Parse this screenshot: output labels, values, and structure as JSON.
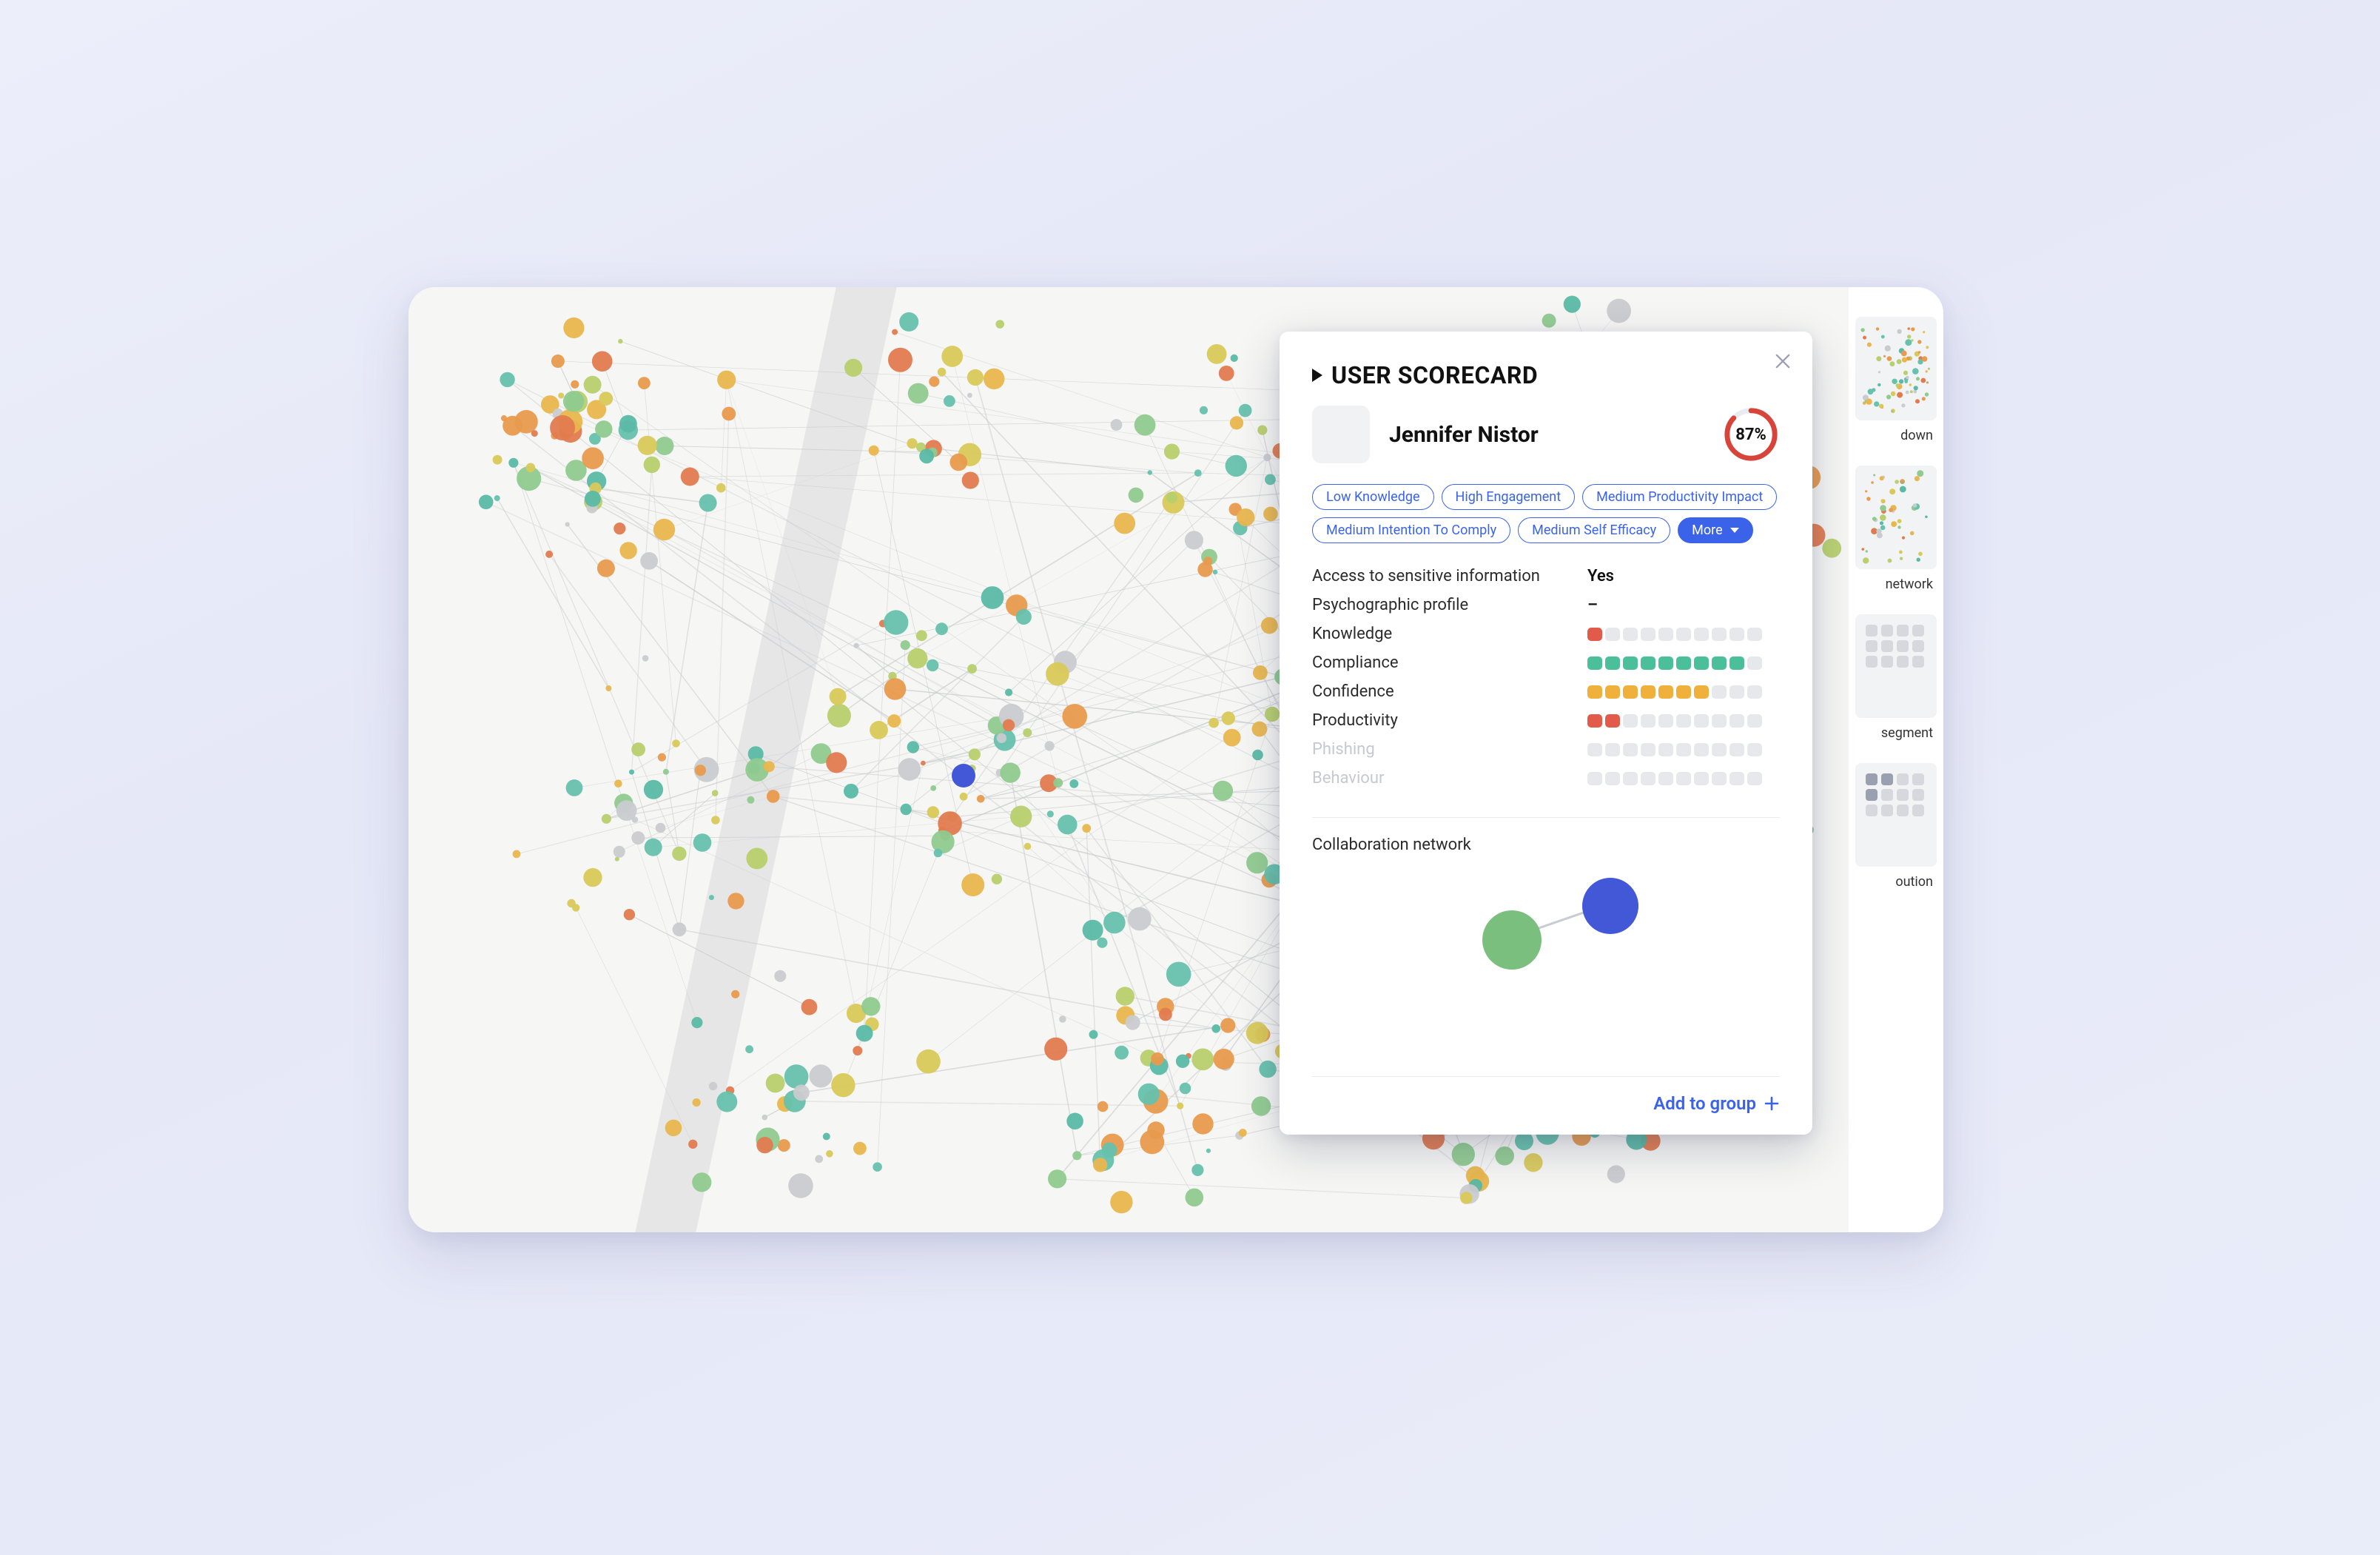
{
  "card": {
    "title": "USER SCORECARD",
    "close_icon": "close",
    "user": {
      "name": "Jennifer Nistor",
      "score_percent": 87,
      "score_label": "87%"
    },
    "tags": [
      {
        "label": "Low Knowledge"
      },
      {
        "label": "High Engagement"
      },
      {
        "label": "Medium Productivity Impact"
      },
      {
        "label": "Medium Intention To Comply"
      },
      {
        "label": "Medium Self Efficacy"
      }
    ],
    "more_label": "More",
    "metrics": {
      "access_label": "Access to sensitive information",
      "access_value": "Yes",
      "psycho_label": "Psychographic profile",
      "psycho_value": "–",
      "knowledge_label": "Knowledge",
      "knowledge_bar": [
        "r",
        "",
        "",
        "",
        "",
        "",
        "",
        "",
        "",
        ""
      ],
      "compliance_label": "Compliance",
      "compliance_bar": [
        "g",
        "g",
        "g",
        "g",
        "g",
        "g",
        "g",
        "g",
        "g",
        ""
      ],
      "confidence_label": "Confidence",
      "confidence_bar": [
        "o",
        "o",
        "o",
        "o",
        "o",
        "o",
        "o",
        "",
        "",
        ""
      ],
      "productivity_label": "Productivity",
      "productivity_bar": [
        "r",
        "r",
        "",
        "",
        "",
        "",
        "",
        "",
        "",
        ""
      ],
      "phishing_label": "Phishing",
      "phishing_bar": [
        "",
        "",
        "",
        "",
        "",
        "",
        "",
        "",
        "",
        ""
      ],
      "behaviour_label": "Behaviour",
      "behaviour_bar": [
        "",
        "",
        "",
        "",
        "",
        "",
        "",
        "",
        "",
        ""
      ]
    },
    "collab_label": "Collaboration network",
    "add_group_label": "Add to group"
  },
  "right_col": {
    "items": [
      {
        "caption": "down"
      },
      {
        "caption": "network"
      },
      {
        "caption": "segment"
      },
      {
        "caption": "oution"
      }
    ]
  },
  "colors": {
    "accent": "#3b63ea",
    "ring": "#d9443a",
    "ring_bg": "#e8ebf2",
    "green": "#4bbf9a",
    "orange": "#efb13b",
    "red": "#e25b4a"
  }
}
